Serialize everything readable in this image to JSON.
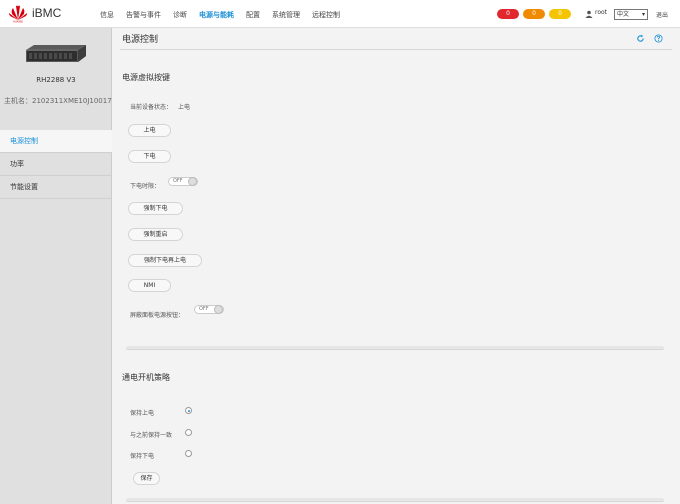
{
  "header": {
    "brand": "iBMC",
    "nav": [
      {
        "label": "信息",
        "active": false
      },
      {
        "label": "告警与事件",
        "active": false
      },
      {
        "label": "诊断",
        "active": false
      },
      {
        "label": "电源与能耗",
        "active": true
      },
      {
        "label": "配置",
        "active": false
      },
      {
        "label": "系统管理",
        "active": false
      },
      {
        "label": "远程控制",
        "active": false
      }
    ],
    "alarms": [
      {
        "count": "0",
        "color": "#e0282e"
      },
      {
        "count": "0",
        "color": "#f08a00"
      },
      {
        "count": "0",
        "color": "#f5c400"
      }
    ],
    "user": "root",
    "language": "中文",
    "logout": "退出"
  },
  "sidebar": {
    "model": "RH2288 V3",
    "host": "主机名：2102311XME10J10017...",
    "menu": [
      {
        "label": "电源控制",
        "active": true
      },
      {
        "label": "功率",
        "active": false
      },
      {
        "label": "节能设置",
        "active": false
      }
    ]
  },
  "main": {
    "title": "电源控制",
    "virtual_buttons": {
      "title": "电源虚拟按键",
      "status_label": "当前设备状态：",
      "status_value": "上电",
      "power_on": "上电",
      "power_off": "下电",
      "power_off_timeout_label": "下电时限：",
      "power_off_timeout_state": "OFF",
      "force_power_off": "强制下电",
      "force_restart": "强制重启",
      "force_power_cycle": "强制下电再上电",
      "nmi": "NMI",
      "shield_panel_label": "屏蔽面板电源按钮：",
      "shield_panel_state": "OFF"
    },
    "power_policy": {
      "title": "通电开机策略",
      "options": [
        {
          "label": "保持上电",
          "selected": true
        },
        {
          "label": "与之前保持一致",
          "selected": false
        },
        {
          "label": "保持下电",
          "selected": false
        }
      ],
      "save": "保存"
    }
  }
}
